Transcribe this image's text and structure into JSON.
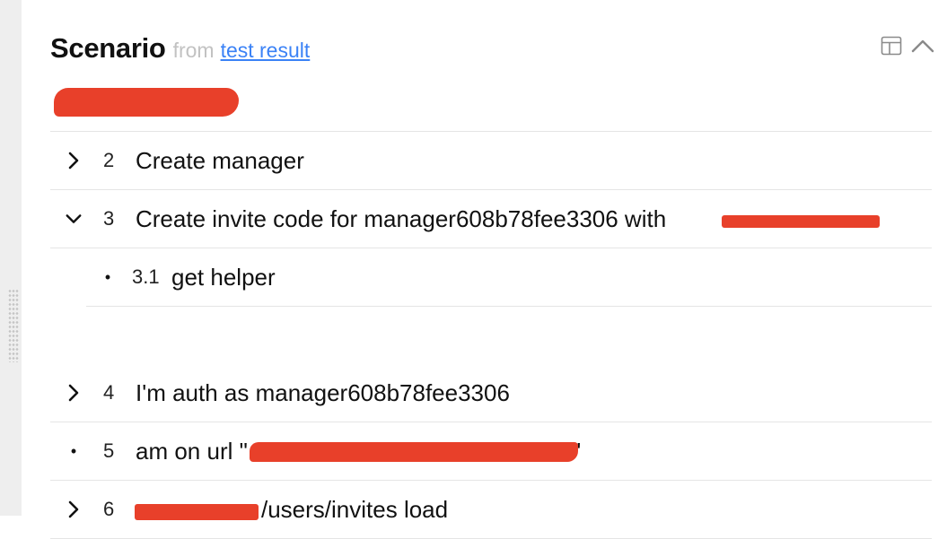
{
  "header": {
    "title": "Scenario",
    "from_label": "from",
    "source_link": "test result"
  },
  "steps": [
    {
      "num": "2",
      "text": "Create manager",
      "state": "collapsed"
    },
    {
      "num": "3",
      "text": "Create invite code for manager608b78fee3306 with",
      "state": "expanded"
    },
    {
      "num": "3.1",
      "text": "get helper",
      "state": "leaf"
    },
    {
      "num": "4",
      "text": "I'm auth as manager608b78fee3306",
      "state": "collapsed"
    },
    {
      "num": "5",
      "text": "am on url \"",
      "suffix": "\"",
      "state": "leaf"
    },
    {
      "num": "6",
      "text": "/users/invites load",
      "state": "collapsed"
    }
  ],
  "colors": {
    "redaction": "#e8402a",
    "link": "#3b82f6",
    "muted": "#c2c2c2",
    "divider": "#e5e5e5"
  },
  "icons": {
    "layout_toggle": "layout-panel-icon",
    "collapse": "chevron-up-icon",
    "collapsed_step": "chevron-right-icon",
    "expanded_step": "chevron-down-icon",
    "leaf_step": "bullet-dot"
  }
}
